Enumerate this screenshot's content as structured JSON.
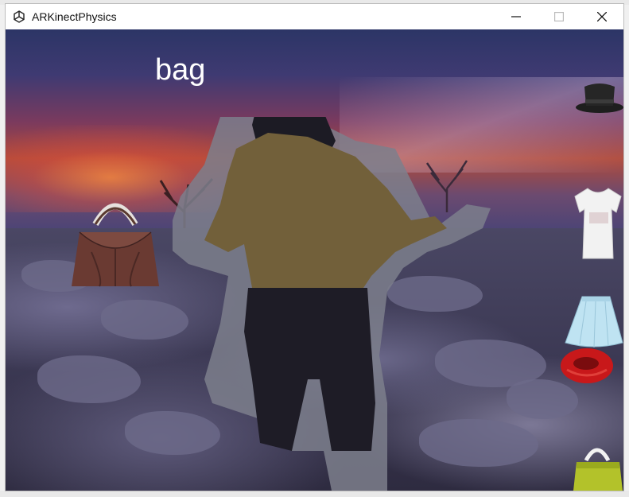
{
  "window": {
    "title": "ARKinectPhysics",
    "controls": [
      "minimize",
      "maximize",
      "close"
    ]
  },
  "scene": {
    "selected_item_label": "bag",
    "left_item": "handbag-brown",
    "right_items": [
      "top-hat",
      "white-tshirt",
      "blue-skirt",
      "red-scarf",
      "yellow-handbag"
    ]
  },
  "colors": {
    "title_bar": "#ffffff",
    "label_text": "#ffffff"
  }
}
